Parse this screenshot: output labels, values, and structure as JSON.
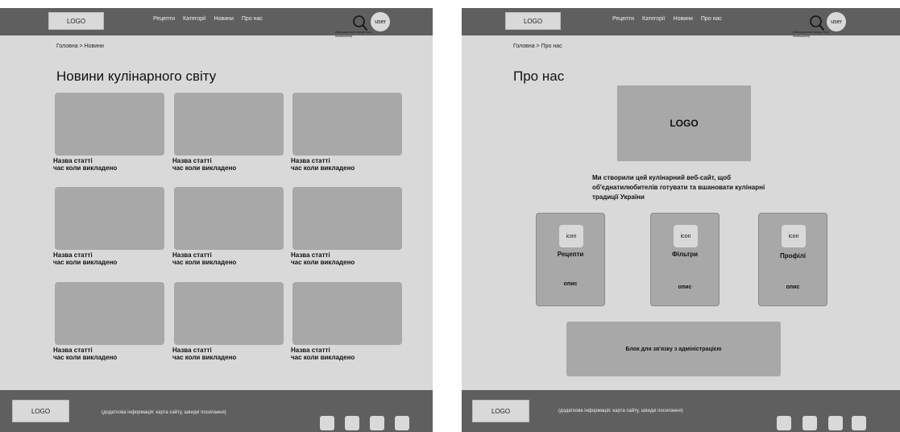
{
  "header": {
    "logo": "LOGO",
    "nav": [
      "Рецепти",
      "Категорії",
      "Новини",
      "Про нас"
    ],
    "user": "user",
    "search_note": "(Випадаючий пошук при натисканні)"
  },
  "news_page": {
    "breadcrumb": "Головна > Новини",
    "title": "Новини кулінарного світу",
    "cards": [
      {
        "title": "Назва статті",
        "time": "час коли викладено"
      },
      {
        "title": "Назва статті",
        "time": "час коли викладено"
      },
      {
        "title": "Назва статті",
        "time": "час коли викладено"
      },
      {
        "title": "Назва статті",
        "time": "час коли викладено"
      },
      {
        "title": "Назва статті",
        "time": "час коли викладено"
      },
      {
        "title": "Назва статті",
        "time": "час коли викладено"
      },
      {
        "title": "Назва статті",
        "time": "час коли викладено"
      },
      {
        "title": "Назва статті",
        "time": "час коли викладено"
      },
      {
        "title": "Назва статті",
        "time": "час коли викладено"
      }
    ]
  },
  "about_page": {
    "breadcrumb": "Головна > Про нас",
    "title": "Про нас",
    "logo": "LOGO",
    "description": "Ми створили цей кулінарний веб-сайт, щоб об'єднатилюбителів готувати та вшановати кулінарні традиції України",
    "features": [
      {
        "icon": "icon",
        "label": "Рецепти",
        "desc": "опис"
      },
      {
        "icon": "icon",
        "label": "Фільтри",
        "desc": "опис"
      },
      {
        "icon": "icon",
        "label": "Профілі",
        "desc": "опис"
      }
    ],
    "contact": "Блок для зв'язку з адміністрацією"
  },
  "footer": {
    "logo": "LOGO",
    "info": "(додаткова інформація: карта сайту, швидкі посилання)"
  }
}
